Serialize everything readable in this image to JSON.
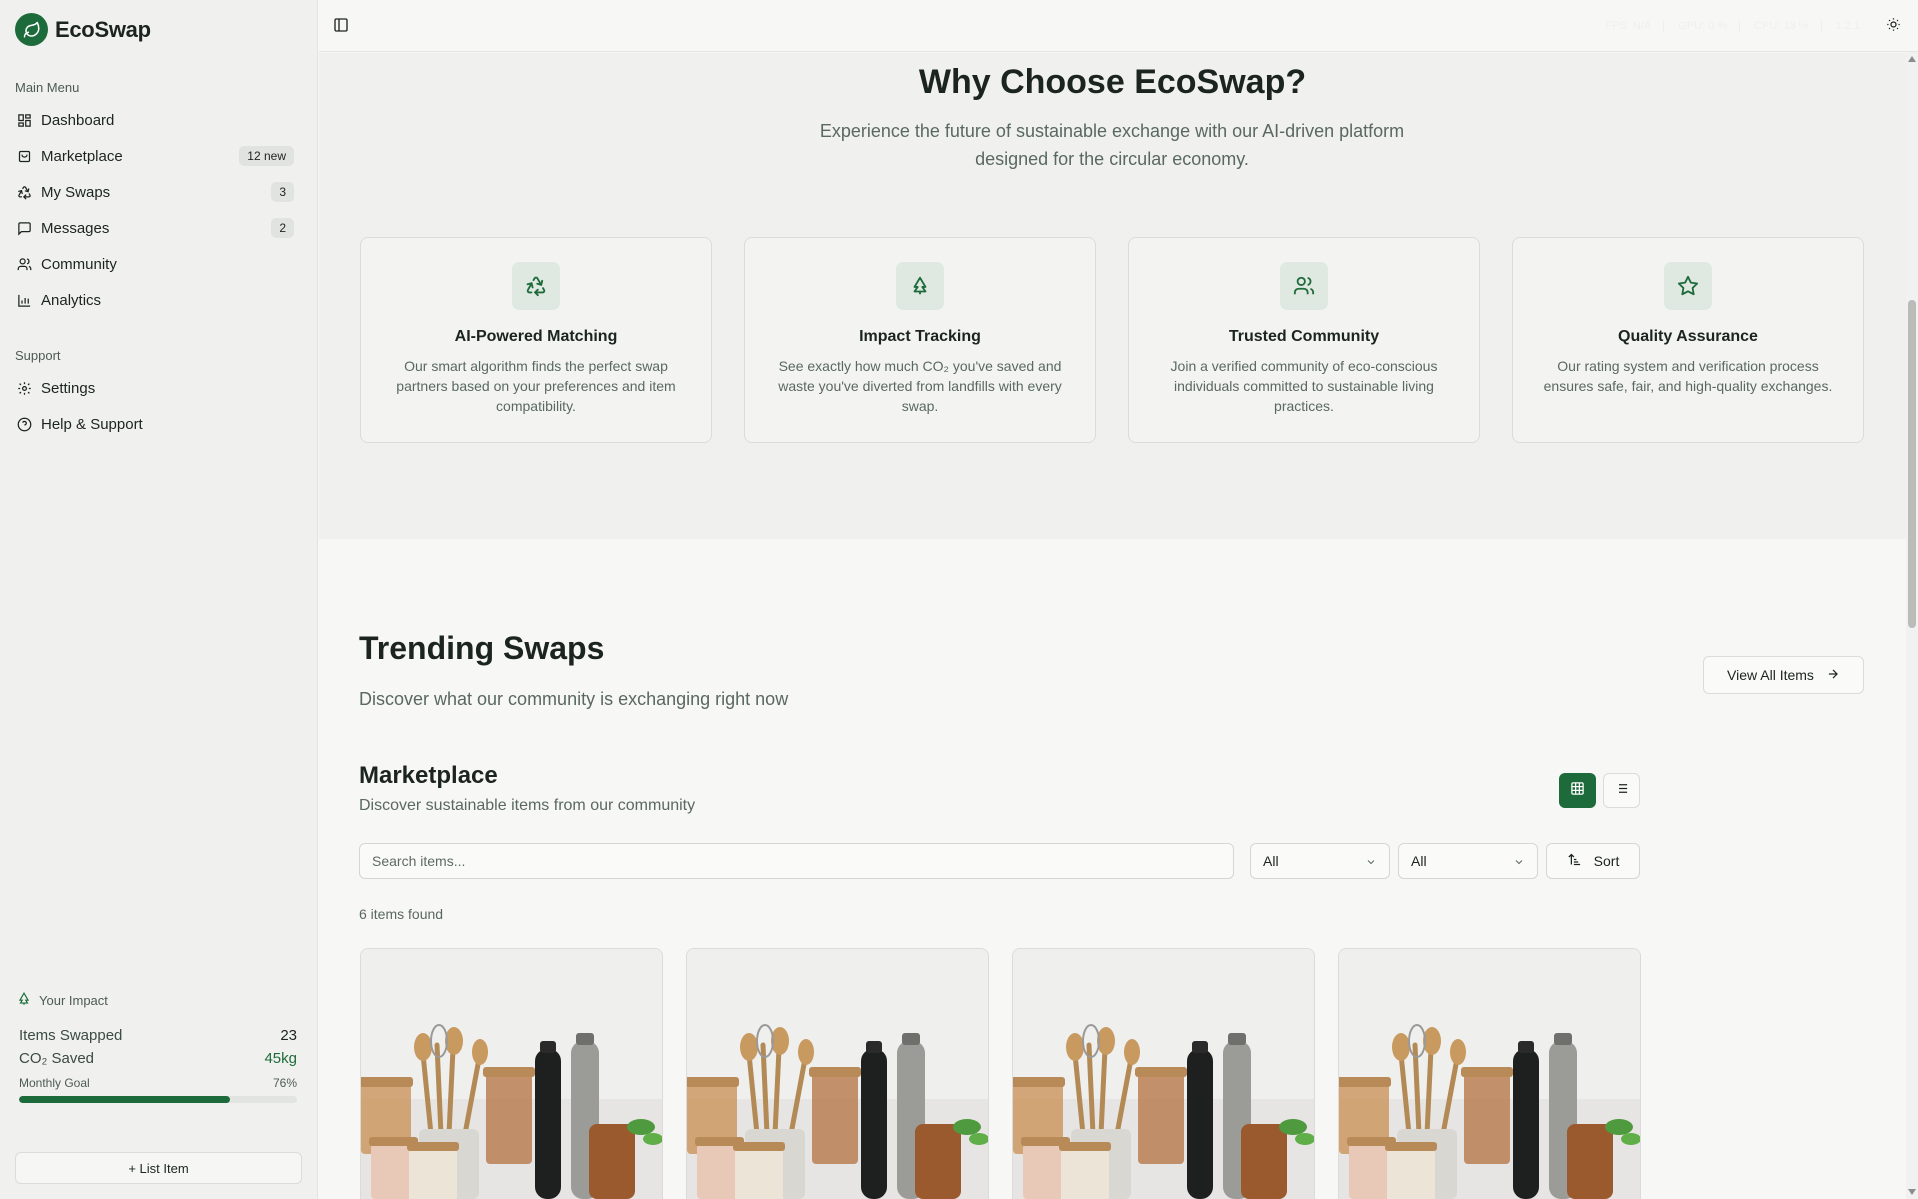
{
  "brand": {
    "name": "EcoSwap"
  },
  "sidebar": {
    "main_menu_label": "Main Menu",
    "items": [
      {
        "label": "Dashboard",
        "icon": "dashboard-icon"
      },
      {
        "label": "Marketplace",
        "icon": "shopping-bag-icon",
        "badge": "12 new"
      },
      {
        "label": "My Swaps",
        "icon": "recycle-icon",
        "badge": "3"
      },
      {
        "label": "Messages",
        "icon": "message-icon",
        "badge": "2"
      },
      {
        "label": "Community",
        "icon": "users-icon"
      },
      {
        "label": "Analytics",
        "icon": "bar-chart-icon"
      }
    ],
    "support_label": "Support",
    "support_items": [
      {
        "label": "Settings",
        "icon": "gear-icon"
      },
      {
        "label": "Help & Support",
        "icon": "help-circle-icon"
      }
    ],
    "impact": {
      "title": "Your Impact",
      "items_swapped_label": "Items Swapped",
      "items_swapped_value": "23",
      "co2_label": "CO₂ Saved",
      "co2_value": "45kg",
      "goal_label": "Monthly Goal",
      "goal_value": "76%",
      "goal_fraction": 0.76
    },
    "list_item_button": "+ List Item"
  },
  "topbar": {
    "stats": [
      "FPS: N/A",
      "GPU: 0 %",
      "CPU: 13 %",
      "1.2.1"
    ]
  },
  "why": {
    "title": "Why Choose EcoSwap?",
    "subtitle": "Experience the future of sustainable exchange with our AI-driven platform designed for the circular economy.",
    "features": [
      {
        "icon": "recycle-icon",
        "title": "AI-Powered Matching",
        "text": "Our smart algorithm finds the perfect swap partners based on your preferences and item compatibility."
      },
      {
        "icon": "tree-icon",
        "title": "Impact Tracking",
        "text": "See exactly how much CO₂ you've saved and waste you've diverted from landfills with every swap."
      },
      {
        "icon": "users-icon",
        "title": "Trusted Community",
        "text": "Join a verified community of eco-conscious individuals committed to sustainable living practices."
      },
      {
        "icon": "star-icon",
        "title": "Quality Assurance",
        "text": "Our rating system and verification process ensures safe, fair, and high-quality exchanges."
      }
    ]
  },
  "trending": {
    "title": "Trending Swaps",
    "subtitle": "Discover what our community is exchanging right now",
    "view_all": "View All Items"
  },
  "marketplace": {
    "title": "Marketplace",
    "subtitle": "Discover sustainable items from our community",
    "search_placeholder": "Search items...",
    "filter_category": "All",
    "filter_condition": "All",
    "sort_label": "Sort",
    "found_text": "6 items found"
  },
  "colors": {
    "accent": "#1d6b3a",
    "background": "#f7f7f6",
    "sidebar": "#f0f1ef"
  }
}
